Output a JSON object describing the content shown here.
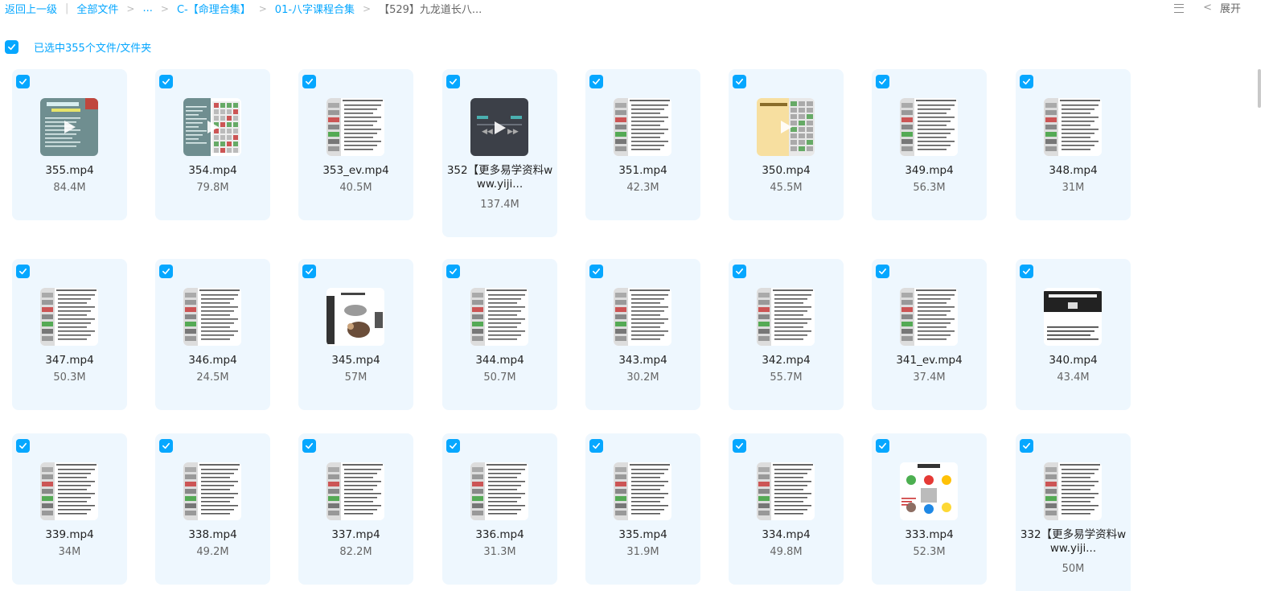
{
  "breadcrumb": {
    "back": "返回上一级",
    "all_files": "全部文件",
    "ellipsis": "...",
    "folder_1": "C-【命理合集】",
    "folder_2": "01-八字课程合集",
    "current": "【529】九龙道长八..."
  },
  "toolbar": {
    "expand_label": "展开",
    "list_icon": "list-view-icon",
    "collapse_icon": "chevron-left-icon"
  },
  "selection": {
    "label": "已选中355个文件/文件夹",
    "check_icon": "checkmark-icon"
  },
  "colors": {
    "accent": "#06a7ff",
    "card_bg": "#eef7fe"
  },
  "files": [
    {
      "name": "355.mp4",
      "size": "84.4M",
      "thumb": "teal",
      "checked": true
    },
    {
      "name": "354.mp4",
      "size": "79.8M",
      "thumb": "teal-split",
      "checked": true
    },
    {
      "name": "353_ev.mp4",
      "size": "40.5M",
      "thumb": "doc",
      "checked": true
    },
    {
      "name": "352【更多易学资料www.yiji...",
      "size": "137.4M",
      "thumb": "dark",
      "checked": true
    },
    {
      "name": "351.mp4",
      "size": "42.3M",
      "thumb": "doc",
      "checked": true
    },
    {
      "name": "350.mp4",
      "size": "45.5M",
      "thumb": "yellow",
      "checked": true
    },
    {
      "name": "349.mp4",
      "size": "56.3M",
      "thumb": "doc",
      "checked": true
    },
    {
      "name": "348.mp4",
      "size": "31M",
      "thumb": "doc",
      "checked": true
    },
    {
      "name": "347.mp4",
      "size": "50.3M",
      "thumb": "doc",
      "checked": true
    },
    {
      "name": "346.mp4",
      "size": "24.5M",
      "thumb": "doc",
      "checked": true
    },
    {
      "name": "345.mp4",
      "size": "57M",
      "thumb": "animal",
      "checked": true
    },
    {
      "name": "344.mp4",
      "size": "50.7M",
      "thumb": "doc",
      "checked": true
    },
    {
      "name": "343.mp4",
      "size": "30.2M",
      "thumb": "doc",
      "checked": true
    },
    {
      "name": "342.mp4",
      "size": "55.7M",
      "thumb": "doc",
      "checked": true
    },
    {
      "name": "341_ev.mp4",
      "size": "37.4M",
      "thumb": "doc",
      "checked": true
    },
    {
      "name": "340.mp4",
      "size": "43.4M",
      "thumb": "textdark",
      "checked": true
    },
    {
      "name": "339.mp4",
      "size": "34M",
      "thumb": "doc",
      "checked": true
    },
    {
      "name": "338.mp4",
      "size": "49.2M",
      "thumb": "doc",
      "checked": true
    },
    {
      "name": "337.mp4",
      "size": "82.2M",
      "thumb": "doc",
      "checked": true
    },
    {
      "name": "336.mp4",
      "size": "31.3M",
      "thumb": "doc",
      "checked": true
    },
    {
      "name": "335.mp4",
      "size": "31.9M",
      "thumb": "doc",
      "checked": true
    },
    {
      "name": "334.mp4",
      "size": "49.8M",
      "thumb": "doc",
      "checked": true
    },
    {
      "name": "333.mp4",
      "size": "52.3M",
      "thumb": "circles",
      "checked": true
    },
    {
      "name": "332【更多易学资料www.yiji...",
      "size": "50M",
      "thumb": "doc",
      "checked": true
    }
  ]
}
